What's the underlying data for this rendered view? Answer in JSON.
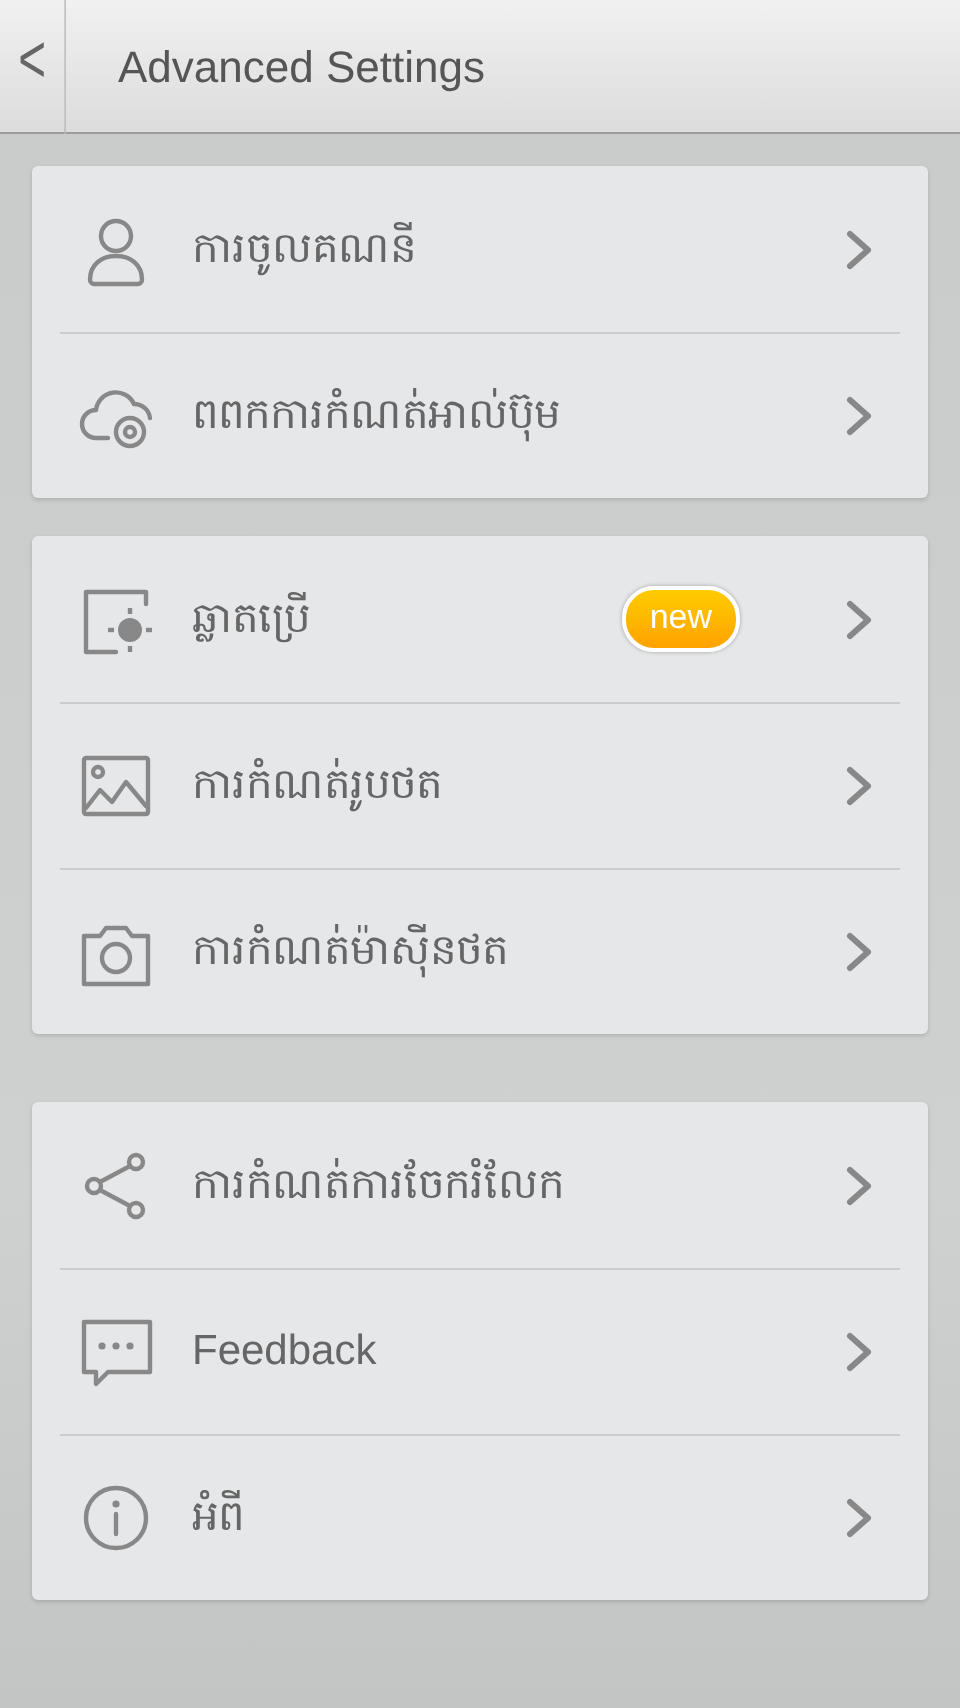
{
  "header": {
    "back": "<",
    "title": "Advanced Settings"
  },
  "groups": [
    {
      "items": [
        {
          "label": "ការចូលគណនី"
        },
        {
          "label": "ពពកការកំណត់អាល់ប៊ុម"
        }
      ]
    },
    {
      "items": [
        {
          "label": "ឆ្លាតប្រើ",
          "badge": "new"
        },
        {
          "label": "ការកំណត់រូបថត"
        },
        {
          "label": "ការកំណត់ម៉ាស៊ីនថត"
        }
      ]
    },
    {
      "items": [
        {
          "label": "ការកំណត់ការចែករំលែក"
        },
        {
          "label": "Feedback"
        },
        {
          "label": "អំពី"
        }
      ]
    }
  ]
}
